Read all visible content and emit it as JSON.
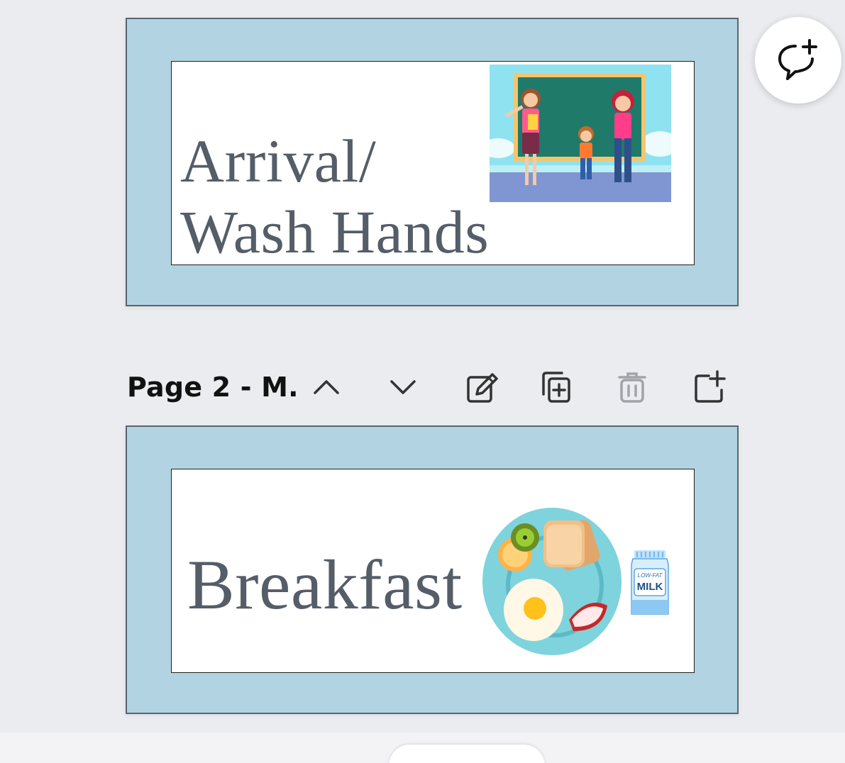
{
  "pages": [
    {
      "title_line1": "Arrival/",
      "title_line2": "Wash Hands",
      "image": "classroom-illustration"
    },
    {
      "title": "Breakfast",
      "image": "breakfast-plate-illustration",
      "milk_label": "MILK",
      "milk_sublabel": "LOW-FAT"
    }
  ],
  "page_toolbar": {
    "label": "Page 2 - M.",
    "icons": [
      "chevron-up-icon",
      "chevron-down-icon",
      "edit-icon",
      "duplicate-icon",
      "trash-icon",
      "add-page-icon"
    ]
  },
  "comment_button": {
    "icon": "add-comment-icon"
  },
  "colors": {
    "page_background": "#b2d4e2",
    "text": "#545d68",
    "workspace": "#ebecf0",
    "icon": "#333333",
    "icon_disabled": "#a0a4a8"
  }
}
